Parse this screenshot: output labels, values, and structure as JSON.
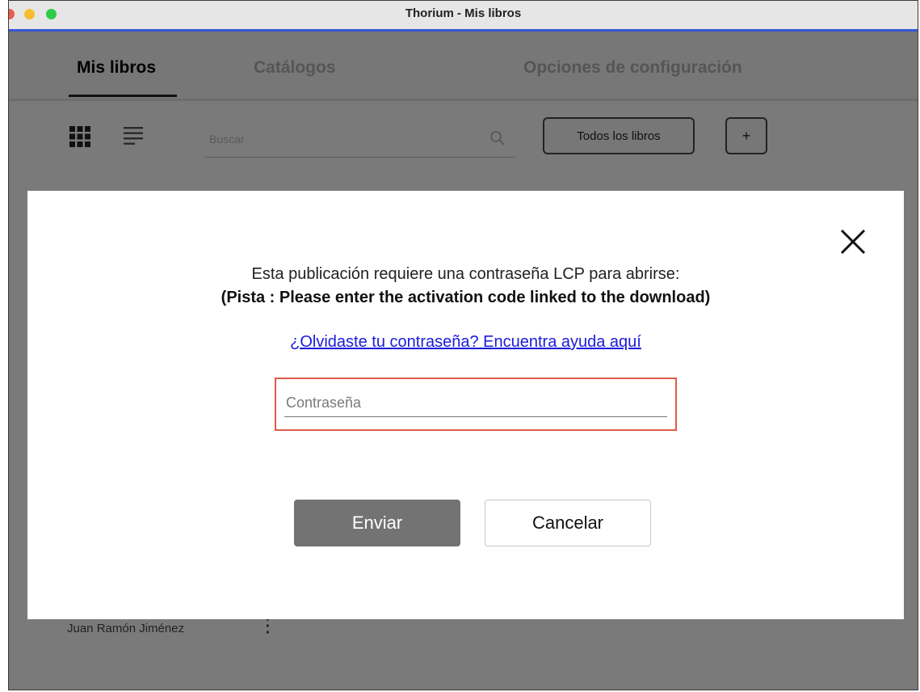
{
  "window": {
    "title": "Thorium - Mis libros"
  },
  "nav": {
    "tabs": [
      {
        "label": "Mis libros",
        "active": true
      },
      {
        "label": "Catálogos",
        "active": false
      },
      {
        "label": "Opciones de configuración",
        "active": false
      }
    ]
  },
  "toolbar": {
    "view_icons": [
      "grid-view-icon",
      "list-view-icon"
    ],
    "search": {
      "placeholder": "Buscar",
      "value": "",
      "icon": "search-icon"
    },
    "all_books_label": "Todos los libros",
    "add_label": "+"
  },
  "library": {
    "books": [
      {
        "author": "Juan Ramón Jiménez",
        "menu_icon": "more-vertical-icon"
      }
    ]
  },
  "dialog": {
    "close_icon": "close-icon",
    "message": "Esta publicación requiere una contraseña LCP para abrirse:",
    "hint": "(Pista : Please enter the activation code linked to the download)",
    "forgot_link": "¿Olvidaste tu contraseña? Encuentra ayuda aquí",
    "password": {
      "placeholder": "Contraseña",
      "value": ""
    },
    "submit_label": "Enviar",
    "cancel_label": "Cancelar"
  },
  "colors": {
    "overlay": "#7a7a7a",
    "title_accent": "#3557d6",
    "link": "#1a1adb",
    "input_highlight": "#e05a48",
    "submit_bg": "#737373"
  }
}
